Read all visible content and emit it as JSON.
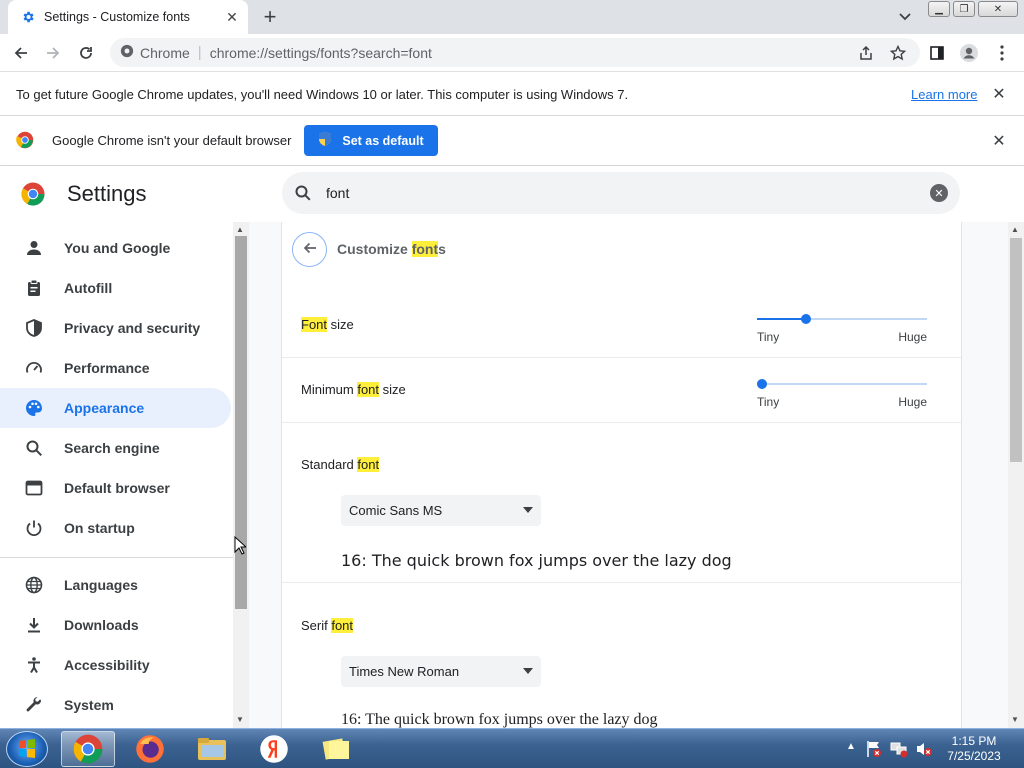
{
  "browser": {
    "tab_title": "Settings - Customize fonts",
    "omnibox_site": "Chrome",
    "omnibox_url": "chrome://settings/fonts?search=font"
  },
  "infobar_update": {
    "message": "To get future Google Chrome updates, you'll need Windows 10 or later. This computer is using Windows 7.",
    "link": "Learn more"
  },
  "infobar_default": {
    "message": "Google Chrome isn't your default browser",
    "button": "Set as default"
  },
  "settings": {
    "title": "Settings",
    "search_value": "font"
  },
  "sidebar": {
    "items": [
      {
        "label": "You and Google",
        "icon": "person-icon"
      },
      {
        "label": "Autofill",
        "icon": "clipboard-icon"
      },
      {
        "label": "Privacy and security",
        "icon": "shield-icon"
      },
      {
        "label": "Performance",
        "icon": "speedometer-icon"
      },
      {
        "label": "Appearance",
        "icon": "palette-icon",
        "active": true
      },
      {
        "label": "Search engine",
        "icon": "search-icon"
      },
      {
        "label": "Default browser",
        "icon": "browser-window-icon"
      },
      {
        "label": "On startup",
        "icon": "power-icon"
      },
      {
        "label": "Languages",
        "icon": "globe-icon"
      },
      {
        "label": "Downloads",
        "icon": "download-icon"
      },
      {
        "label": "Accessibility",
        "icon": "accessibility-icon"
      },
      {
        "label": "System",
        "icon": "wrench-icon"
      }
    ]
  },
  "page": {
    "subtitle_pre": "Customize ",
    "subtitle_hl": "font",
    "subtitle_post": "s",
    "font_size": {
      "label_hl": "Font",
      "label_post": " size",
      "min": "Tiny",
      "max": "Huge",
      "level": 0.29
    },
    "min_font_size": {
      "label_pre": "Minimum ",
      "label_hl": "font",
      "label_post": " size",
      "min": "Tiny",
      "max": "Huge",
      "level": 0.0
    },
    "standard_font": {
      "label_pre": "Standard ",
      "label_hl": "font",
      "value": "Comic Sans MS",
      "sample": "16: The quick brown fox jumps over the lazy dog"
    },
    "serif_font": {
      "label_pre": "Serif ",
      "label_hl": "font",
      "value": "Times New Roman",
      "sample": "16: The quick brown fox jumps over the lazy dog"
    }
  },
  "taskbar": {
    "apps": [
      "chrome-icon",
      "firefox-icon",
      "file-explorer-icon",
      "yandex-icon",
      "sticky-notes-icon"
    ],
    "time": "1:15 PM",
    "date": "7/25/2023"
  },
  "colors": {
    "accent": "#1a73e8",
    "highlight": "#ffef3b",
    "active_nav_bg": "#e8f0fe"
  }
}
